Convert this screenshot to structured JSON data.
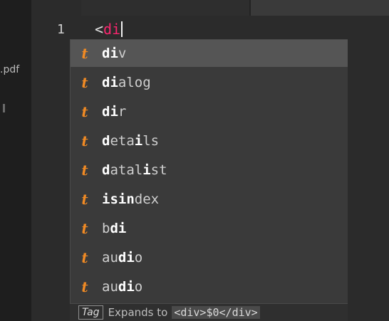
{
  "sidebar": {
    "file_label": ".pdf"
  },
  "editor": {
    "line_number": "1",
    "open_bracket": "<",
    "typed_text": "di"
  },
  "completions": [
    {
      "kind_icon": "t",
      "prefix": "",
      "match": "di",
      "suffix": "v",
      "selected": true
    },
    {
      "kind_icon": "t",
      "prefix": "",
      "match": "di",
      "suffix": "alog",
      "selected": false
    },
    {
      "kind_icon": "t",
      "prefix": "",
      "match": "di",
      "suffix": "r",
      "selected": false
    },
    {
      "kind_icon": "t",
      "prefix": "",
      "match": "d",
      "suffix": "eta",
      "match2": "i",
      "suffix2": "ls",
      "selected": false
    },
    {
      "kind_icon": "t",
      "prefix": "",
      "match": "d",
      "suffix": "atal",
      "match2": "i",
      "suffix2": "st",
      "selected": false
    },
    {
      "kind_icon": "t",
      "prefix": "",
      "match": "isin",
      "suffix": "dex",
      "selected": false
    },
    {
      "kind_icon": "t",
      "prefix": "b",
      "match": "di",
      "suffix": "",
      "selected": false
    },
    {
      "kind_icon": "t",
      "prefix": "au",
      "match": "di",
      "suffix": "o",
      "selected": false
    },
    {
      "kind_icon": "t",
      "prefix": "au",
      "match": "di",
      "suffix": "o",
      "selected": false
    }
  ],
  "footer": {
    "kind": "Tag",
    "text": "Expands to",
    "snippet": "<div>$0</div>"
  },
  "colors": {
    "kind_icon": "#f08a24",
    "typed_text": "#f9266e",
    "selected_row": "#555555"
  }
}
